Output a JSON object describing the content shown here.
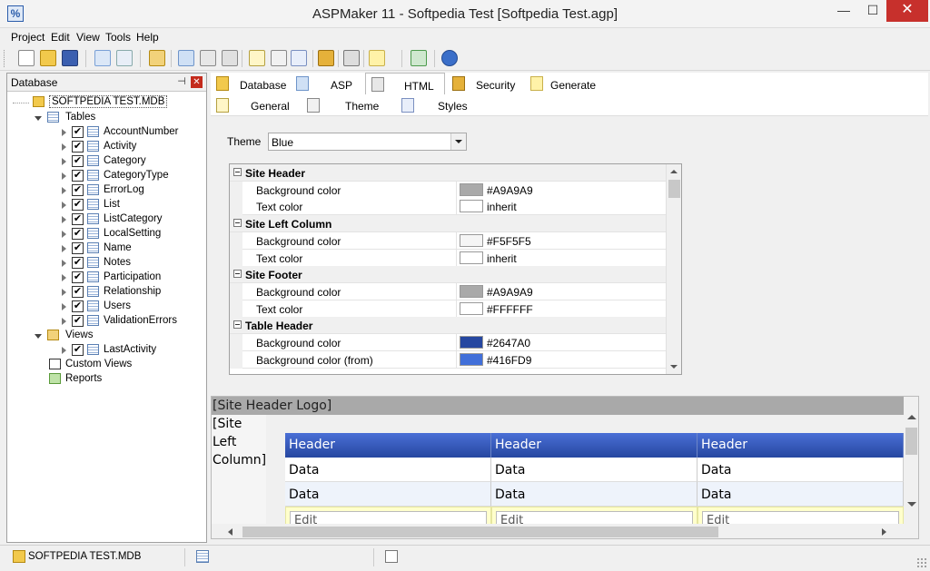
{
  "window": {
    "title": "ASPMaker 11 - Softpedia Test [Softpedia Test.agp]",
    "minimize": "—",
    "maximize": "☐",
    "close": "✕",
    "app_icon_glyph": "%"
  },
  "menu": [
    "Project",
    "Edit",
    "View",
    "Tools",
    "Help"
  ],
  "database_panel": {
    "title": "Database",
    "pin": "⊣",
    "close": "✕",
    "root": "SOFTPEDIA TEST.MDB",
    "tables_label": "Tables",
    "tables": [
      "AccountNumber",
      "Activity",
      "Category",
      "CategoryType",
      "ErrorLog",
      "List",
      "ListCategory",
      "LocalSetting",
      "Name",
      "Notes",
      "Participation",
      "Relationship",
      "Users",
      "ValidationErrors"
    ],
    "views_label": "Views",
    "views": [
      "LastActivity"
    ],
    "custom_views_label": "Custom Views",
    "reports_label": "Reports",
    "check": "✔"
  },
  "tabs": [
    "Database",
    "ASP",
    "HTML",
    "Security",
    "Generate"
  ],
  "active_tab": "HTML",
  "subtabs": [
    "General",
    "Theme",
    "Styles"
  ],
  "active_subtab": "Theme",
  "theme": {
    "label": "Theme",
    "value": "Blue"
  },
  "property_grid": {
    "rows": [
      {
        "type": "category",
        "label": "Site Header"
      },
      {
        "type": "prop",
        "name": "Background color",
        "color": "#A9A9A9",
        "value": "#A9A9A9"
      },
      {
        "type": "prop",
        "name": "Text color",
        "color": "#FFFFFF",
        "value": "inherit"
      },
      {
        "type": "category",
        "label": "Site Left Column"
      },
      {
        "type": "prop",
        "name": "Background color",
        "color": "#F5F5F5",
        "value": "#F5F5F5"
      },
      {
        "type": "prop",
        "name": "Text color",
        "color": "#FFFFFF",
        "value": "inherit"
      },
      {
        "type": "category",
        "label": "Site Footer"
      },
      {
        "type": "prop",
        "name": "Background color",
        "color": "#A9A9A9",
        "value": "#A9A9A9"
      },
      {
        "type": "prop",
        "name": "Text color",
        "color": "#FFFFFF",
        "value": "#FFFFFF"
      },
      {
        "type": "category",
        "label": "Table Header"
      },
      {
        "type": "prop",
        "name": "Background color",
        "color": "#2647A0",
        "value": "#2647A0"
      },
      {
        "type": "prop",
        "name": "Background color (from)",
        "color": "#416FD9",
        "value": "#416FD9"
      }
    ]
  },
  "preview": {
    "header": "[Site Header Logo]",
    "left_lines": [
      "[Site",
      "Left",
      "Column]"
    ],
    "table_headers": [
      "Header",
      "Header",
      "Header"
    ],
    "rows": [
      [
        "Data",
        "Data",
        "Data"
      ],
      [
        "Data",
        "Data",
        "Data"
      ]
    ],
    "edit_row": [
      "Edit",
      "Edit",
      "Edit"
    ]
  },
  "statusbar": {
    "db_name": "SOFTPEDIA TEST.MDB"
  },
  "colors": {
    "header_blue": "#2647A0",
    "header_blue_from": "#416FD9",
    "close_red": "#C7302C"
  }
}
